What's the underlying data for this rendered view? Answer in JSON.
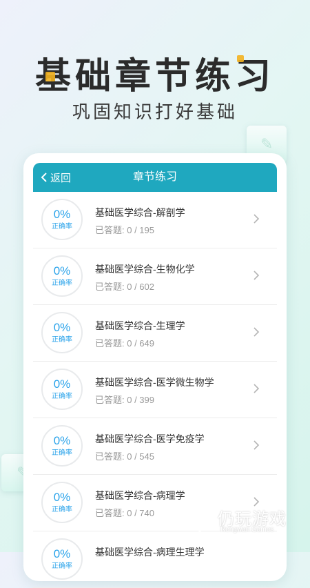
{
  "hero": {
    "title": "基础章节练习",
    "subtitle": "巩固知识打好基础"
  },
  "appbar": {
    "back_label": "返回",
    "title": "章节练习"
  },
  "chapters": [
    {
      "percent": "0%",
      "percent_label": "正确率",
      "title": "基础医学综合-解剖学",
      "progress": "已答题: 0 / 195"
    },
    {
      "percent": "0%",
      "percent_label": "正确率",
      "title": "基础医学综合-生物化学",
      "progress": "已答题: 0 / 602"
    },
    {
      "percent": "0%",
      "percent_label": "正确率",
      "title": "基础医学综合-生理学",
      "progress": "已答题: 0 / 649"
    },
    {
      "percent": "0%",
      "percent_label": "正确率",
      "title": "基础医学综合-医学微生物学",
      "progress": "已答题: 0 / 399"
    },
    {
      "percent": "0%",
      "percent_label": "正确率",
      "title": "基础医学综合-医学免疫学",
      "progress": "已答题: 0 / 545"
    },
    {
      "percent": "0%",
      "percent_label": "正确率",
      "title": "基础医学综合-病理学",
      "progress": "已答题: 0 / 740"
    },
    {
      "percent": "0%",
      "percent_label": "正确率",
      "title": "基础医学综合-病理生理学",
      "progress": ""
    }
  ],
  "watermark": {
    "name": "仍玩游戏",
    "sub": "Rengwan Games"
  },
  "colors": {
    "appbar": "#1fa8bf",
    "percent": "#2aa3ea",
    "accent": "#f3b320"
  }
}
